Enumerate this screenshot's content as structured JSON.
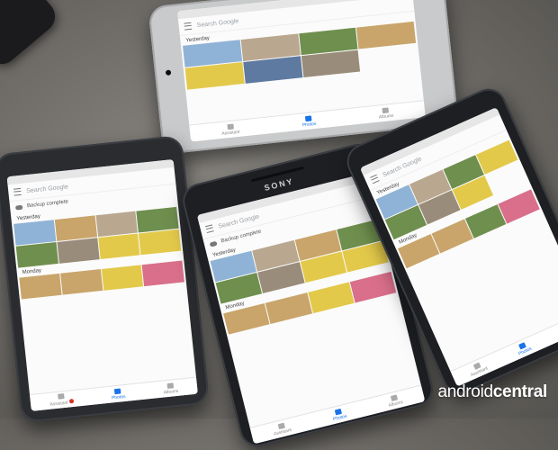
{
  "app": {
    "search_placeholder": "Search Google",
    "backup_status": "Backup complete",
    "sections": [
      "Yesterday",
      "Monday"
    ],
    "nav": [
      {
        "label": "Assistant",
        "icon": "assistant-icon"
      },
      {
        "label": "Photos",
        "icon": "photos-icon"
      },
      {
        "label": "Albums",
        "icon": "albums-icon"
      }
    ]
  },
  "brand_text": "SONY",
  "watermark": {
    "prefix": "android",
    "suffix": "central"
  },
  "colors": {
    "table": "#7a7773",
    "accent": "#1a73e8",
    "photo_tones": [
      "#8fb3d6",
      "#c9a56b",
      "#6f8f4e",
      "#e3c94a",
      "#b9a78f",
      "#d96f8a",
      "#5e7aa0",
      "#9a8c7a"
    ]
  }
}
